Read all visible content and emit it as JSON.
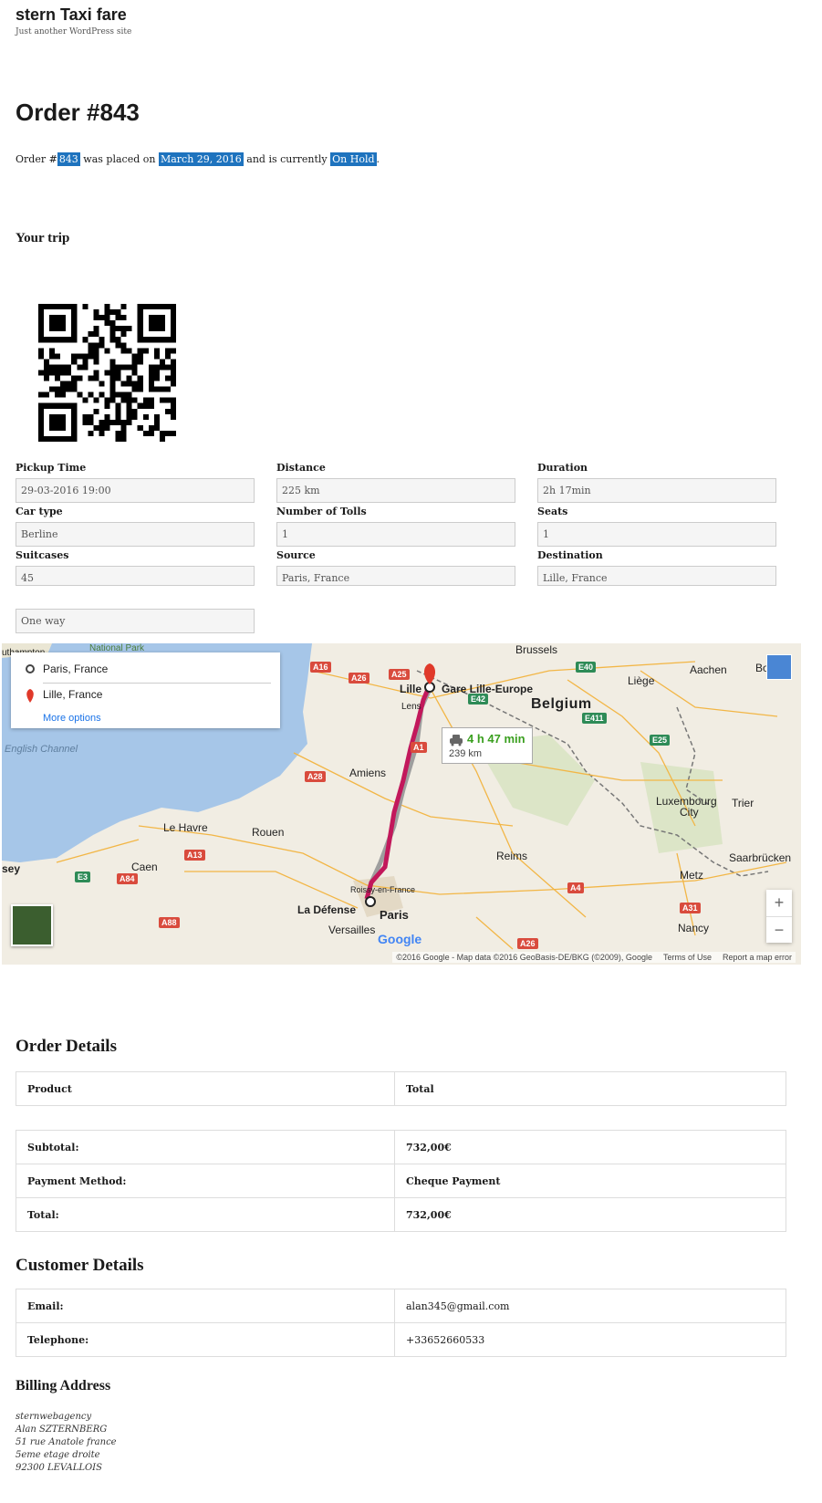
{
  "site": {
    "title": "stern Taxi fare",
    "description": "Just another WordPress site"
  },
  "order": {
    "title": "Order #843",
    "line": {
      "p1": "Order #",
      "number": "843",
      "p2": " was placed on ",
      "date": "March 29, 2016",
      "p3": " and is currently ",
      "status": "On Hold",
      "p4": "."
    }
  },
  "trip": {
    "title": "Your trip",
    "fields": [
      {
        "label": "Pickup Time",
        "value": "29-03-2016 19:00"
      },
      {
        "label": "Distance",
        "value": "225 km"
      },
      {
        "label": "Duration",
        "value": "2h 17min"
      },
      {
        "label": "Car type",
        "value": "Berline"
      },
      {
        "label": "Number of Tolls",
        "value": "1"
      },
      {
        "label": "Seats",
        "value": "1"
      },
      {
        "label": "Suitcases",
        "value": "45"
      },
      {
        "label": "Source",
        "value": "Paris, France"
      },
      {
        "label": "Destination",
        "value": "Lille, France"
      }
    ],
    "trip_type": "One way"
  },
  "map": {
    "origin": "Paris, France",
    "destination": "Lille, France",
    "more_options": "More options",
    "duration": "4 h 47 min",
    "distance": "239 km",
    "labels": {
      "brussels": "Brussels",
      "belgium": "Belgium",
      "lille": "Lille",
      "gare": "Gare Lille-Europe",
      "lens": "Lens",
      "aachen": "Aachen",
      "liege": "Liège",
      "amiens": "Amiens",
      "english_channel": "English Channel",
      "le_havre": "Le Havre",
      "rouen": "Rouen",
      "caen": "Caen",
      "reims": "Reims",
      "luxembourg": "Luxembourg",
      "city": "City",
      "trier": "Trier",
      "saarbrucken": "Saarbrücken",
      "metz": "Metz",
      "nancy": "Nancy",
      "roissy": "Roissy-en-France",
      "la_defense": "La Défense",
      "paris": "Paris",
      "versailles": "Versailles",
      "national_park": "National Park",
      "southampton": "uthampton",
      "sey": "sey",
      "bo": "Bo"
    },
    "roads": [
      "A16",
      "A26",
      "A25",
      "A1",
      "A28",
      "A13",
      "A84",
      "A88",
      "A4",
      "A31",
      "A26",
      "E40",
      "E42",
      "E411",
      "E25",
      "E3"
    ],
    "attribution": "©2016 Google - Map data ©2016 GeoBasis-DE/BKG (©2009), Google",
    "terms": "Terms of Use",
    "report": "Report a map error",
    "google": "Google",
    "zoom_in": "+",
    "zoom_out": "−"
  },
  "order_details": {
    "title": "Order Details",
    "header": {
      "product": "Product",
      "total": "Total"
    },
    "rows": [
      {
        "label": "Subtotal:",
        "value": "732,00€"
      },
      {
        "label": "Payment Method:",
        "value": "Cheque Payment"
      },
      {
        "label": "Total:",
        "value": "732,00€"
      }
    ]
  },
  "customer_details": {
    "title": "Customer Details",
    "rows": [
      {
        "label": "Email:",
        "value": "alan345@gmail.com"
      },
      {
        "label": "Telephone:",
        "value": "+33652660533"
      }
    ]
  },
  "billing": {
    "title": "Billing Address",
    "lines": [
      "sternwebagency",
      "Alan SZTERNBERG",
      "51 rue Anatole france",
      "5eme etage droite",
      "92300 LEVALLOIS"
    ]
  },
  "colors": {
    "accent": "#1e73be",
    "route": "#c2185b",
    "route_alt": "#9e9e9e",
    "duration": "#3a9f1f"
  }
}
